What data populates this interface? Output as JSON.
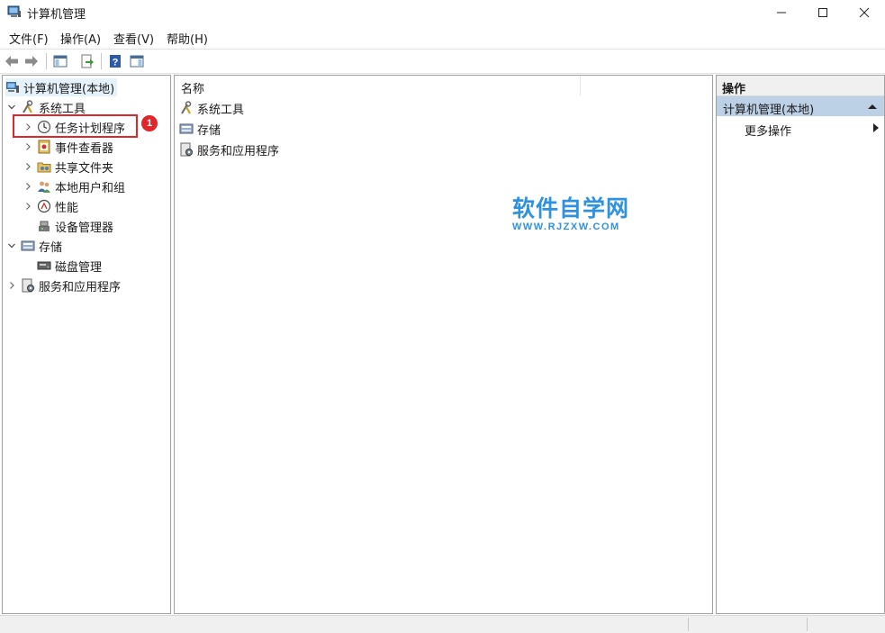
{
  "window": {
    "title": "计算机管理",
    "icon": "computer-management-icon",
    "controls": [
      "minimize-icon",
      "maximize-icon",
      "close-icon"
    ]
  },
  "menu": [
    "文件(F)",
    "操作(A)",
    "查看(V)",
    "帮助(H)"
  ],
  "toolbar": {
    "buttons": [
      "back-arrow-icon",
      "forward-arrow-icon",
      "show-hide-tree-icon",
      "export-list-icon",
      "help-icon",
      "show-hide-action-pane-icon"
    ]
  },
  "tree": {
    "root": "计算机管理(本地)",
    "items": [
      {
        "label": "系统工具",
        "expanded": true,
        "icon": "tools-icon"
      },
      {
        "label": "任务计划程序",
        "icon": "clock-icon"
      },
      {
        "label": "事件查看器",
        "icon": "event-viewer-icon"
      },
      {
        "label": "共享文件夹",
        "icon": "shared-folder-icon"
      },
      {
        "label": "本地用户和组",
        "icon": "users-icon"
      },
      {
        "label": "性能",
        "icon": "performance-icon"
      },
      {
        "label": "设备管理器",
        "icon": "device-manager-icon"
      },
      {
        "label": "存储",
        "expanded": true,
        "icon": "storage-icon"
      },
      {
        "label": "磁盘管理",
        "icon": "disk-icon"
      },
      {
        "label": "服务和应用程序",
        "icon": "services-icon"
      }
    ]
  },
  "center": {
    "column_header": "名称",
    "rows": [
      "系统工具",
      "存储",
      "服务和应用程序"
    ]
  },
  "actions": {
    "header": "操作",
    "selected": "计算机管理(本地)",
    "more": "更多操作"
  },
  "annotation": {
    "badge": "1",
    "color": "#e0262b"
  },
  "watermark": {
    "cn": "软件自学网",
    "en": "WWW.RJZXW.COM",
    "color": "#2e92e0"
  }
}
